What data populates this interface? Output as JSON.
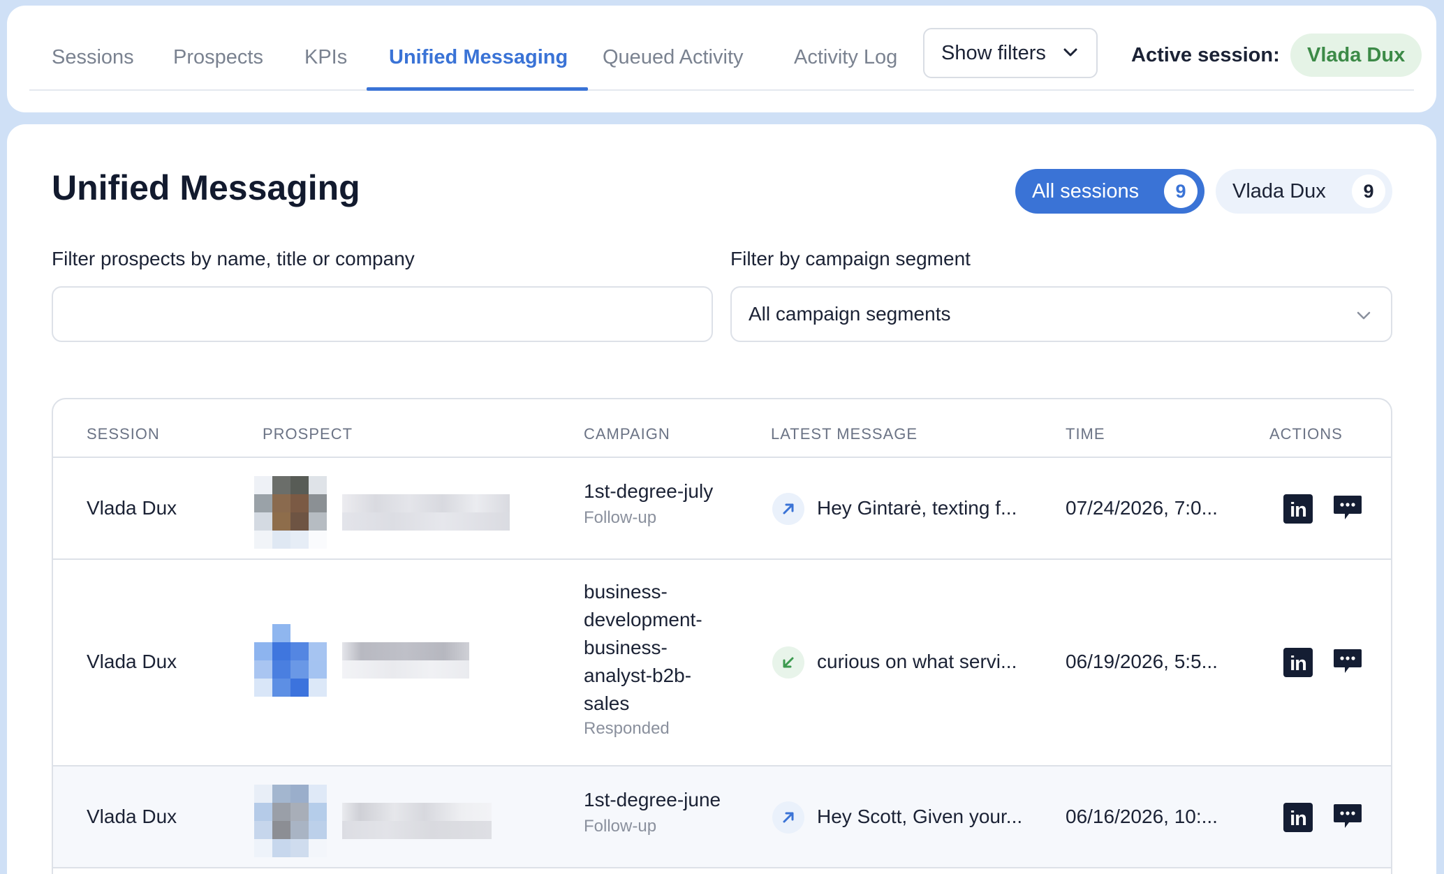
{
  "nav": {
    "tabs": [
      {
        "label": "Sessions"
      },
      {
        "label": "Prospects"
      },
      {
        "label": "KPIs"
      },
      {
        "label": "Unified Messaging",
        "active": true
      },
      {
        "label": "Queued Activity"
      },
      {
        "label": "Activity Log"
      }
    ],
    "show_filters_label": "Show filters",
    "active_session_label": "Active session:",
    "active_session_name": "Vlada Dux"
  },
  "page": {
    "title": "Unified Messaging",
    "session_pills": [
      {
        "label": "All sessions",
        "count": "9",
        "selected": true
      },
      {
        "label": "Vlada Dux",
        "count": "9",
        "selected": false
      }
    ],
    "filters": {
      "prospect_label": "Filter prospects by name, title or company",
      "prospect_value": "",
      "segment_label": "Filter by campaign segment",
      "segment_value": "All campaign segments"
    }
  },
  "table": {
    "columns": [
      "SESSION",
      "PROSPECT",
      "CAMPAIGN",
      "LATEST MESSAGE",
      "TIME",
      "ACTIONS"
    ],
    "rows": [
      {
        "session": "Vlada Dux",
        "prospect": "(blurred)",
        "campaign_lines": [
          "1st-degree-july"
        ],
        "campaign_status": "Follow-up",
        "direction": "outgoing",
        "message": "Hey Gintarė, texting f...",
        "time": "07/24/2026, 7:0..."
      },
      {
        "session": "Vlada Dux",
        "prospect": "(blurred)",
        "campaign_lines": [
          "business-",
          "development-",
          "business-",
          "analyst-b2b-",
          "sales"
        ],
        "campaign_status": "Responded",
        "direction": "incoming",
        "message": "curious on what servi...",
        "time": "06/19/2026, 5:5..."
      },
      {
        "session": "Vlada Dux",
        "prospect": "(blurred)",
        "campaign_lines": [
          "1st-degree-june"
        ],
        "campaign_status": "Follow-up",
        "direction": "outgoing",
        "message": "Hey Scott, Given your...",
        "time": "06/16/2026, 10:..."
      }
    ],
    "action_icons": [
      "linkedin-icon",
      "chat-icon"
    ]
  },
  "colors": {
    "accent": "#3a73d6",
    "active_session_bg": "#e5f3e6",
    "active_session_text": "#3c8a47",
    "page_bg": "#cfe0f6"
  }
}
